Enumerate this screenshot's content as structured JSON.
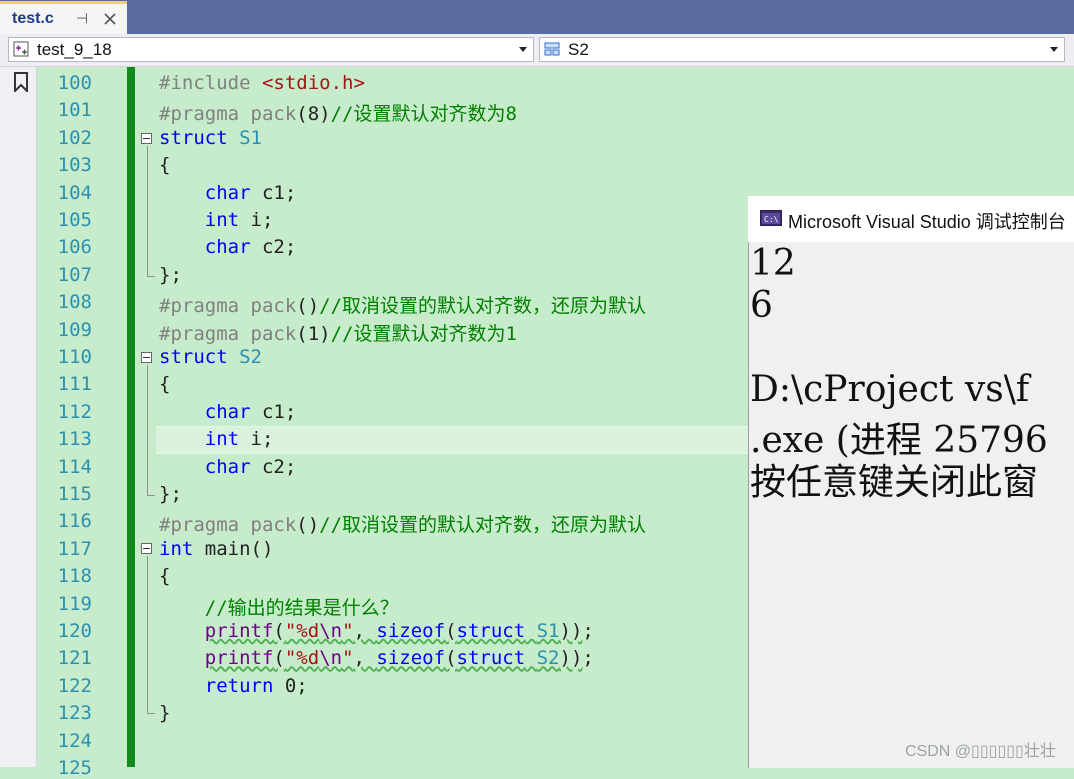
{
  "tab": {
    "title": "test.c",
    "pin_glyph": "⊣",
    "close_icon": "close-icon"
  },
  "nav": {
    "project": "test_9_18",
    "member": "S2"
  },
  "code_lines": [
    {
      "n": "100",
      "html": "<span class=\"pp\">#include </span><span class=\"st\">&lt;stdio.h&gt;</span>"
    },
    {
      "n": "101",
      "html": "<span class=\"pp\">#pragma pack</span>(8)<span class=\"cm\">//设置默认对齐数为8</span>"
    },
    {
      "n": "102",
      "html": "<span class=\"kw\">struct</span> <span class=\"ty\">S1</span>"
    },
    {
      "n": "103",
      "html": "{"
    },
    {
      "n": "104",
      "html": "    <span class=\"kw\">char</span> c1;"
    },
    {
      "n": "105",
      "html": "    <span class=\"kw\">int</span> i;"
    },
    {
      "n": "106",
      "html": "    <span class=\"kw\">char</span> c2;"
    },
    {
      "n": "107",
      "html": "};"
    },
    {
      "n": "108",
      "html": "<span class=\"pp\">#pragma pack</span>()<span class=\"cm\">//取消设置的默认对齐数，还原为默认</span>"
    },
    {
      "n": "109",
      "html": "<span class=\"pp\">#pragma pack</span>(1)<span class=\"cm\">//设置默认对齐数为1</span>"
    },
    {
      "n": "110",
      "html": "<span class=\"kw\">struct</span> <span class=\"ty\">S2</span>"
    },
    {
      "n": "111",
      "html": "{"
    },
    {
      "n": "112",
      "html": "    <span class=\"kw\">char</span> c1;"
    },
    {
      "n": "113",
      "html": "    <span class=\"kw\">int</span> i;"
    },
    {
      "n": "114",
      "html": "    <span class=\"kw\">char</span> c2;"
    },
    {
      "n": "115",
      "html": "};"
    },
    {
      "n": "116",
      "html": "<span class=\"pp\">#pragma pack</span>()<span class=\"cm\">//取消设置的默认对齐数，还原为默认</span>"
    },
    {
      "n": "117",
      "html": "<span class=\"kw\">int</span> main()"
    },
    {
      "n": "118",
      "html": "{"
    },
    {
      "n": "119",
      "html": "    <span class=\"cm\">//输出的结果是什么？</span>"
    },
    {
      "n": "120",
      "html": "    <span class=\"mac wavy\">printf</span><span class=\"wavy\">(<span class=\"st\">\"%d<span class=\"mac\">\\n</span>\"</span>, <span class=\"kw\">sizeof</span>(<span class=\"kw\">struct</span> <span class=\"ty\">S1</span>))</span>;"
    },
    {
      "n": "121",
      "html": "    <span class=\"mac wavy\">printf</span><span class=\"wavy\">(<span class=\"st\">\"%d<span class=\"mac\">\\n</span>\"</span>, <span class=\"kw\">sizeof</span>(<span class=\"kw\">struct</span> <span class=\"ty\">S2</span>))</span>;"
    },
    {
      "n": "122",
      "html": "    <span class=\"kw\">return</span> 0;"
    },
    {
      "n": "123",
      "html": "}"
    },
    {
      "n": "124",
      "html": ""
    },
    {
      "n": "125",
      "html": ""
    }
  ],
  "console": {
    "title": "Microsoft Visual Studio 调试控制台",
    "lines": [
      "12",
      "6",
      "",
      "D:\\cProject vs\\f",
      ".exe (进程 25796",
      "按任意键关闭此窗"
    ]
  },
  "watermark": "CSDN @▯▯▯▯▯▯壮壮",
  "colors": {
    "editor_bg": "#c7eccb",
    "tab_bar": "#5a6b9e",
    "change_bar": "#128a1c",
    "keyword": "#0000ff",
    "type": "#2b91af",
    "comment": "#008000"
  }
}
